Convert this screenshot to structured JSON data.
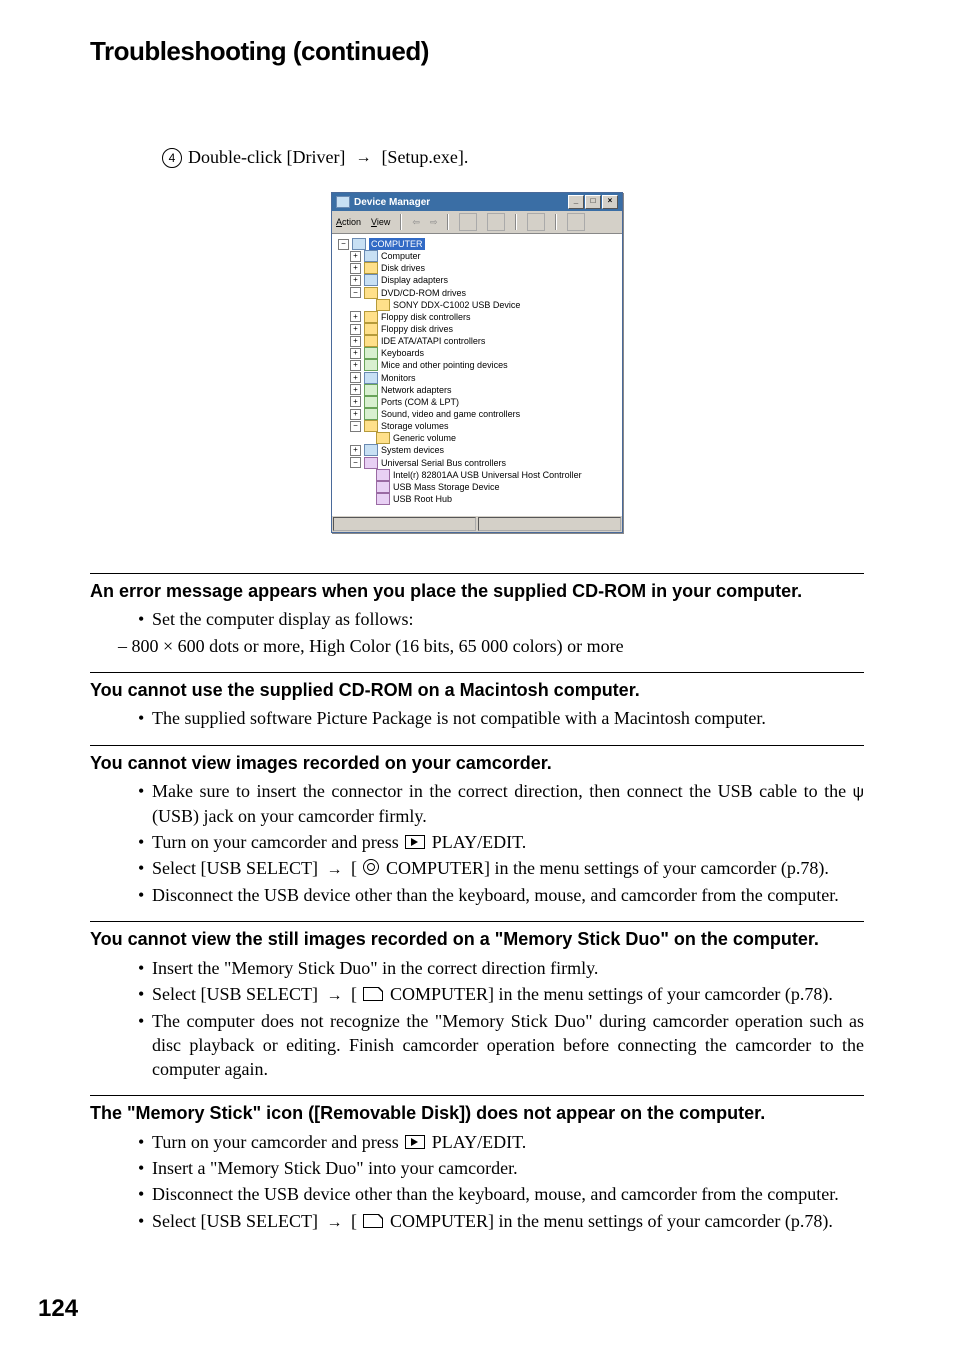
{
  "title": "Troubleshooting (continued)",
  "step": {
    "num": "4",
    "pre": "Double-click [Driver]",
    "post": "[Setup.exe]."
  },
  "dm": {
    "title": "Device Manager",
    "menu": {
      "action": "Action",
      "view": "View"
    },
    "root": "COMPUTER",
    "items": [
      "Computer",
      "Disk drives",
      "Display adapters",
      "DVD/CD-ROM drives"
    ],
    "sub_dvd": "SONY DDX-C1002 USB Device",
    "items2": [
      "Floppy disk controllers",
      "Floppy disk drives",
      "IDE ATA/ATAPI controllers",
      "Keyboards",
      "Mice and other pointing devices",
      "Monitors",
      "Network adapters",
      "Ports (COM & LPT)",
      "Sound, video and game controllers",
      "Storage volumes"
    ],
    "sub_storage": "Generic volume",
    "items3": [
      "System devices",
      "Universal Serial Bus controllers"
    ],
    "usb_children": [
      "Intel(r) 82801AA USB Universal Host Controller",
      "USB Mass Storage Device",
      "USB Root Hub"
    ]
  },
  "sec1": {
    "head": "An error message appears when you place the supplied CD-ROM in your computer.",
    "b1": "Set the computer display as follows:",
    "sub": "–  800 × 600 dots or more, High Color (16 bits, 65 000 colors) or more"
  },
  "sec2": {
    "head": "You cannot use the supplied CD-ROM on a Macintosh computer.",
    "b1": "The supplied software Picture Package is not compatible with a Macintosh computer."
  },
  "sec3": {
    "head": "You cannot view images recorded on your camcorder.",
    "b1a": "Make sure to insert the connector in the correct direction, then connect the USB cable to the ",
    "b1b": " (USB) jack on your camcorder firmly.",
    "b2a": "Turn on your camcorder and press ",
    "b2b": " PLAY/EDIT.",
    "b3a": "Select [USB SELECT] ",
    "b3b": " [ ",
    "b3c": " COMPUTER] in the menu settings of your camcorder (p.78).",
    "b4": "Disconnect the USB device other than the keyboard, mouse, and camcorder from the computer."
  },
  "sec4": {
    "head": "You cannot view the still images recorded on a \"Memory Stick Duo\" on the computer.",
    "b1": "Insert the \"Memory Stick Duo\" in the correct direction firmly.",
    "b2a": "Select [USB SELECT] ",
    "b2b": " [ ",
    "b2c": " COMPUTER] in the menu settings of your camcorder (p.78).",
    "b3": "The computer does not recognize the \"Memory Stick Duo\" during camcorder operation such as disc playback or editing. Finish camcorder operation before connecting the camcorder to the computer again."
  },
  "sec5": {
    "head": "The \"Memory Stick\" icon ([Removable Disk]) does not appear on the computer.",
    "b1a": "Turn on your camcorder and press ",
    "b1b": " PLAY/EDIT.",
    "b2": "Insert a \"Memory Stick Duo\" into your camcorder.",
    "b3": "Disconnect the USB device other than the keyboard, mouse, and camcorder from the computer.",
    "b4a": "Select [USB SELECT] ",
    "b4b": " [ ",
    "b4c": " COMPUTER] in the menu settings of your camcorder (p.78)."
  },
  "pagenum": "124"
}
